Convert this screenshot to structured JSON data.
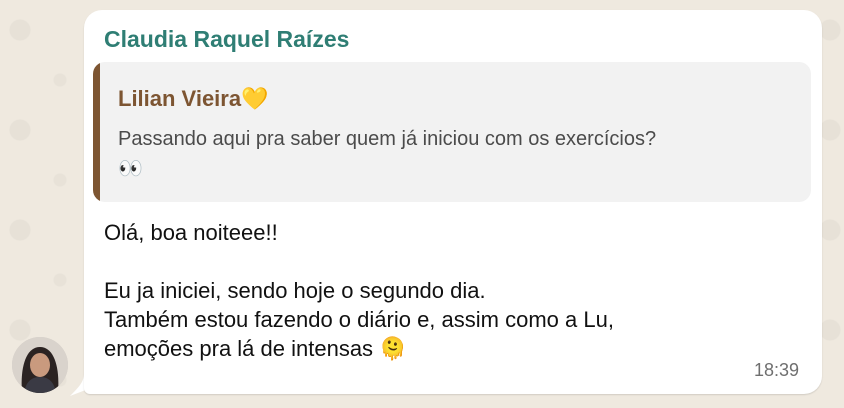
{
  "message": {
    "sender_name": "Claudia Raquel Raízes",
    "quoted": {
      "author": "Lilian Vieira",
      "author_emoji": "💛",
      "text": "Passando aqui pra saber quem já iniciou com os exercícios?",
      "text_emoji": "👀"
    },
    "body_line_1": "Olá, boa noiteee!!",
    "body_line_2": "Eu ja iniciei, sendo hoje o segundo dia.",
    "body_line_3": "Também estou fazendo o diário e, assim como a Lu,",
    "body_line_4": "emoções pra lá de intensas",
    "body_emoji": "🫠",
    "time": "18:39"
  },
  "colors": {
    "sender": "#2f7e74",
    "quote_author": "#7d5532",
    "quote_bar": "#7d5532",
    "background": "#efe9df"
  }
}
